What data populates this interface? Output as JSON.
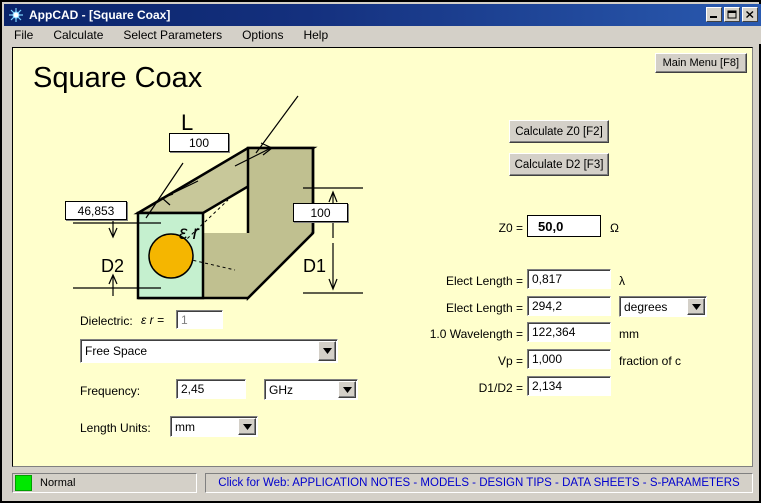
{
  "window": {
    "title": "AppCAD - [Square Coax]",
    "icon": "app-icon",
    "controls": {
      "minimize": "minimize-icon",
      "maximize": "maximize-icon",
      "close": "close-icon"
    }
  },
  "menubar": {
    "items": [
      {
        "label": "File"
      },
      {
        "label": "Calculate"
      },
      {
        "label": "Select Parameters"
      },
      {
        "label": "Options"
      },
      {
        "label": "Help"
      }
    ]
  },
  "page": {
    "title": "Square Coax",
    "main_menu_button": "Main Menu  [F8]"
  },
  "diagram": {
    "length_label": "L",
    "length_value": "100",
    "d2_label": "D2",
    "d2_value": "46,853",
    "d1_label": "D1",
    "d1_value": "100",
    "dielectric_symbol": "ε r",
    "colors": {
      "front_face": "#c5f0cf",
      "top_face": "#c8c89a",
      "side_face": "#c0c090",
      "conductor": "#f5b600",
      "outline": "#000000"
    }
  },
  "inputs": {
    "dielectric_label": "Dielectric:",
    "epsilon_label": "ε r =",
    "epsilon_value": "1",
    "material": "Free Space",
    "frequency_label": "Frequency:",
    "frequency_value": "2,45",
    "frequency_unit": "GHz",
    "length_units_label": "Length Units:",
    "length_units_value": "mm"
  },
  "actions": {
    "calculate_z0": "Calculate Z0  [F2]",
    "calculate_d2": "Calculate D2  [F3]"
  },
  "results": {
    "z0_label": "Z0 =",
    "z0_value": "50,0",
    "z0_unit": "Ω",
    "elect_length_lambda_label": "Elect Length =",
    "elect_length_lambda_value": "0,817",
    "elect_length_lambda_unit": "λ",
    "elect_length_deg_label": "Elect Length =",
    "elect_length_deg_value": "294,2",
    "elect_length_deg_unit": "degrees",
    "wavelength_label": "1.0 Wavelength =",
    "wavelength_value": "122,364",
    "wavelength_unit": "mm",
    "vp_label": "Vp =",
    "vp_value": "1,000",
    "vp_unit": "fraction of c",
    "ratio_label": "D1/D2 =",
    "ratio_value": "2,134"
  },
  "statusbar": {
    "state": "Normal",
    "state_color": "#00e800",
    "weblink": "Click for Web: APPLICATION NOTES - MODELS - DESIGN TIPS - DATA SHEETS - S-PARAMETERS",
    "weblink_color": "#0000cd"
  }
}
